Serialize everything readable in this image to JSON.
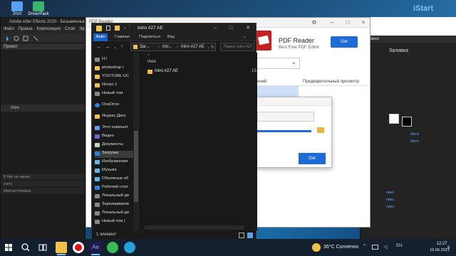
{
  "desktop": {
    "icons": [
      {
        "label": "Этот",
        "icon": "this-pc-icon",
        "color": "#5aa0f0"
      },
      {
        "label": "DriverPack",
        "icon": "driverpack-icon",
        "color": "#3cb371"
      }
    ]
  },
  "after_effects": {
    "title": "Adobe After Effects 2020 - Безымянный",
    "menu": [
      "Файл",
      "Правка",
      "Композиция",
      "Слой",
      "Эф"
    ],
    "project_panel": "Проект",
    "col_name": "Имя",
    "fps_text": "8 бит на канал",
    "timeline_tab": "(нет)",
    "source_col": "Имя источника",
    "right_items": [
      "справке",
      "Заливка",
      "Авто",
      "Авто",
      "пикс.",
      "пикс.",
      "пикс."
    ],
    "accent": "#5aa0f0"
  },
  "pdf_ad": {
    "title_small": "PDF Reader",
    "name": "PDF Reader",
    "tagline": "Best Free PDF Editor",
    "get_label": "Get",
    "tab1": "ений",
    "tab2": "Предварительный просмотр",
    "dialog_get_label": "Get",
    "accent": "#1e6ad6",
    "progress": 1.0
  },
  "explorer": {
    "title": "Intro #27 AE",
    "ribbon": [
      "Файл",
      "Главная",
      "Поделиться",
      "Вид"
    ],
    "breadcrumb": [
      "Заг...",
      "Intr...",
      "Intro #27 AE"
    ],
    "search_placeholder": "Поиск: Intro #27 AE",
    "nav_items": [
      {
        "label": "H:\\",
        "icon": "drive-icon"
      },
      {
        "label": "photoshop r",
        "icon": "folder-icon"
      },
      {
        "label": "YOUTUBE UC",
        "icon": "folder-icon"
      },
      {
        "label": "Интро 1",
        "icon": "folder-icon"
      },
      {
        "label": "Новый том",
        "icon": "drive-icon"
      },
      {
        "label": "OneDrive",
        "icon": "onedrive-icon"
      },
      {
        "label": "Яндекс.Диск",
        "icon": "folder-icon"
      },
      {
        "label": "Этот компьют",
        "icon": "pc-icon"
      },
      {
        "label": "Видео",
        "icon": "video-folder-icon"
      },
      {
        "label": "Документы",
        "icon": "documents-icon"
      },
      {
        "label": "Загрузки",
        "icon": "downloads-icon"
      },
      {
        "label": "Изображения",
        "icon": "pictures-icon"
      },
      {
        "label": "Музыка",
        "icon": "music-icon"
      },
      {
        "label": "Объемные об",
        "icon": "3d-objects-icon"
      },
      {
        "label": "Рабочий стол",
        "icon": "desktop-icon"
      },
      {
        "label": "Локальный ди",
        "icon": "drive-icon"
      },
      {
        "label": "Зарезервиров",
        "icon": "drive-icon"
      },
      {
        "label": "Локальный ди",
        "icon": "drive-icon"
      },
      {
        "label": "Новый том (",
        "icon": "drive-icon"
      }
    ],
    "selected_nav": "Загрузки",
    "col_name": "Имя",
    "file": {
      "name": "Intro #27 AE",
      "date": "19."
    },
    "status": "1 элемент"
  },
  "istart": {
    "logo": "iStart"
  },
  "taskbar": {
    "weather": "36°C  Солнечно",
    "time": "12:27",
    "date": "19.06.2021",
    "notifications": "8",
    "apps": [
      {
        "icon": "start-icon",
        "color": "#ffffff",
        "active": false
      },
      {
        "icon": "search-icon",
        "color": "#ffffff",
        "active": false
      },
      {
        "icon": "task-view-icon",
        "color": "#ffffff",
        "active": false
      },
      {
        "icon": "file-explorer-icon",
        "color": "#f0c24b",
        "active": true
      },
      {
        "icon": "record-icon",
        "color": "#d11",
        "active": false
      },
      {
        "icon": "after-effects-icon",
        "color": "#1b1b4d",
        "active": true
      },
      {
        "icon": "chrome-icon",
        "color": "#3cba54",
        "active": false
      },
      {
        "icon": "telegram-icon",
        "color": "#2aa1d9",
        "active": false
      }
    ]
  }
}
